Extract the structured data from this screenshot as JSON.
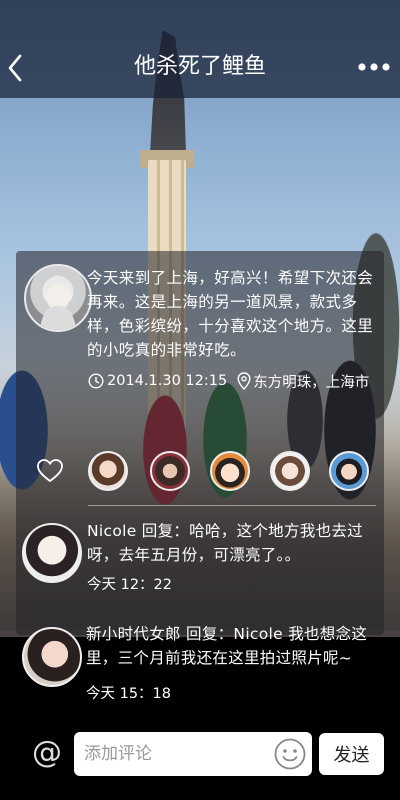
{
  "header": {
    "title": "他杀死了鲤鱼",
    "back_icon": "chevron-left-icon",
    "more_icon": "ellipsis-icon"
  },
  "post": {
    "text": "今天来到了上海，好高兴！希望下次还会再来。这是上海的另一道风景，款式多样，色彩缤纷，十分喜欢这个地方。这里的小吃真的非常好吃。",
    "time": "2014.1.30 12:15",
    "location": "东方明珠，上海市"
  },
  "likes": {
    "heart_icon": "heart-outline-icon",
    "count_avatars": 5
  },
  "comments": [
    {
      "text": "Nicole  回复：哈哈，这个地方我也去过呀，去年五月份，可漂亮了。。",
      "time": "今天 12：22"
    },
    {
      "text": "新小时代女郎 回复：Nicole 我也想念这里，三个月前我还在这里拍过照片呢~",
      "time": "今天 15：18"
    }
  ],
  "composer": {
    "at_symbol": "@",
    "placeholder": "添加评论",
    "send_label": "发送",
    "emoji_icon": "smiley-icon"
  }
}
